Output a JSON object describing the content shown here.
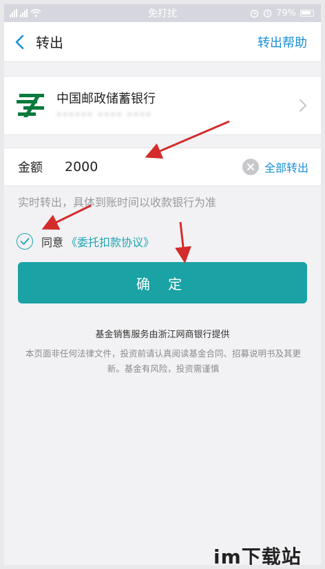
{
  "status_bar": {
    "center": "免打扰",
    "battery": "79%"
  },
  "header": {
    "title": "转出",
    "help": "转出帮助"
  },
  "bank": {
    "name": "中国邮政储蓄银行",
    "card_masked": "****** **** ****"
  },
  "amount": {
    "label": "金额",
    "value": "2000",
    "all_out": "全部转出"
  },
  "notice": "实时转出，具体到账时间以收款银行为准",
  "agreement": {
    "prefix": "同意",
    "link": "《委托扣款协议》"
  },
  "confirm_button": "确 定",
  "footer": {
    "provider": "基金销售服务由浙江网商银行提供",
    "disclaimer": "本页面非任何法律文件，投资前请认真阅读基金合同、招募说明书及其更新。基金有风险，投资需谨慎"
  },
  "watermark": "im下载站",
  "colors": {
    "accent_blue": "#1a8fd8",
    "teal": "#1aa2a4",
    "arrow_red": "#d42b2b",
    "bank_green": "#0a7a3c"
  }
}
